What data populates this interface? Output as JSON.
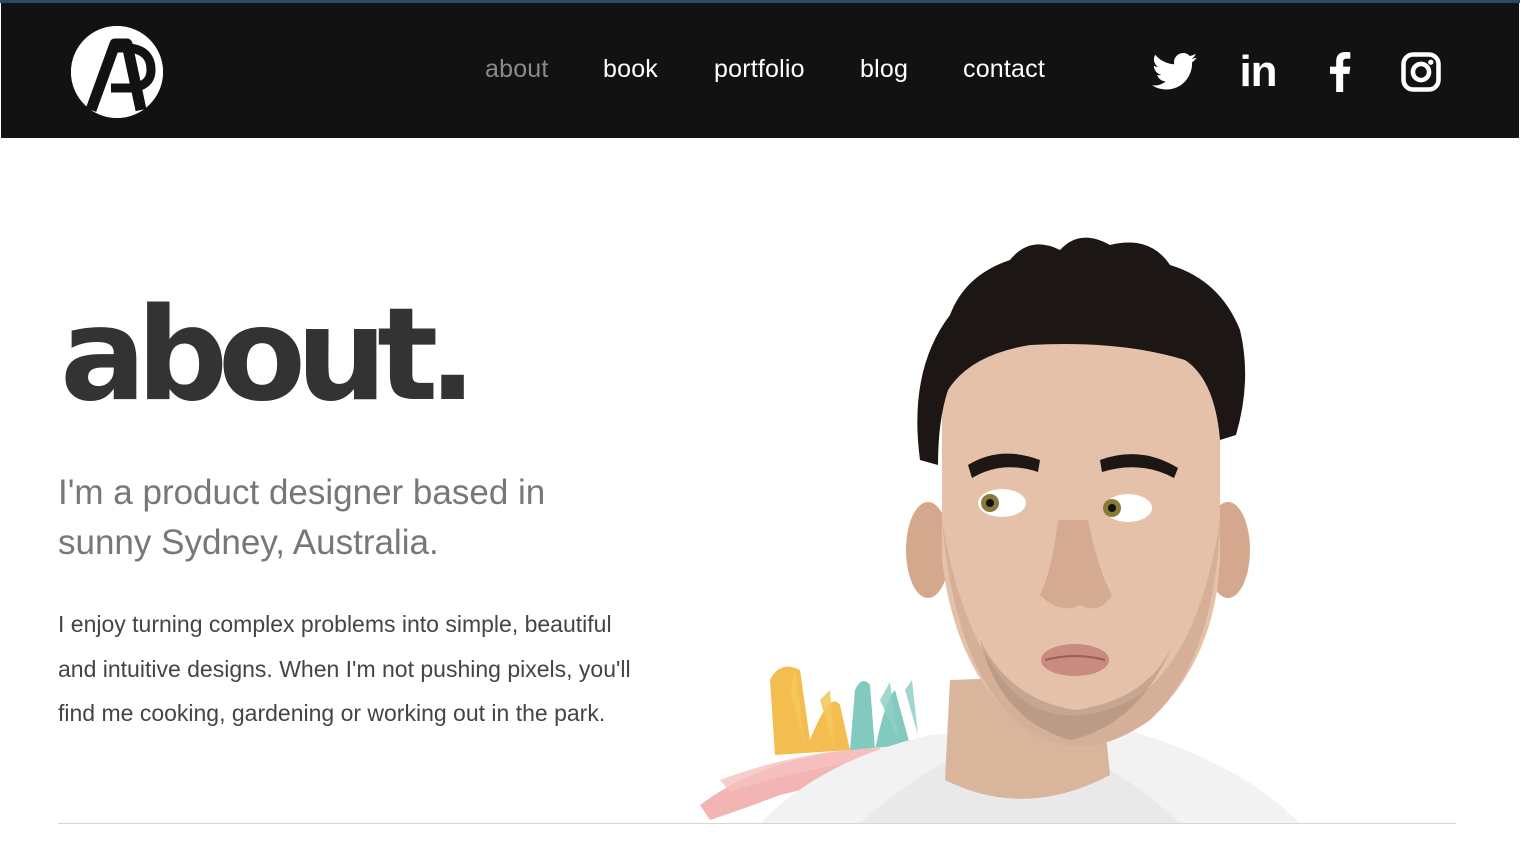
{
  "nav": {
    "logo_letters": "AP",
    "links": [
      {
        "label": "about",
        "active": true
      },
      {
        "label": "book",
        "active": false
      },
      {
        "label": "portfolio",
        "active": false
      },
      {
        "label": "blog",
        "active": false
      },
      {
        "label": "contact",
        "active": false
      }
    ],
    "social": [
      {
        "icon": "twitter-icon"
      },
      {
        "icon": "linkedin-icon",
        "glyph": "in"
      },
      {
        "icon": "facebook-icon"
      },
      {
        "icon": "instagram-icon"
      }
    ]
  },
  "main": {
    "heading": "about.",
    "lead": "I'm a product designer based in sunny Sydney, Australia.",
    "body": "I enjoy turning complex problems into simple, beautiful and intuitive designs. When I'm not pushing pixels, you'll find me cooking, gardening or working out in the park."
  },
  "colors": {
    "navbar_bg": "#121212",
    "nav_text": "#ffffff",
    "nav_active": "#8a8a8a",
    "heading": "#333333",
    "lead": "#777777",
    "body": "#444444",
    "paint_yellow": "#f2b63c",
    "paint_teal": "#6cc0b4",
    "paint_pink": "#f0a8a6"
  }
}
